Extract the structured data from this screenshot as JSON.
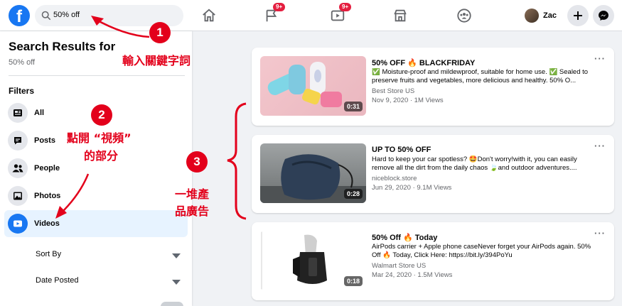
{
  "search": {
    "value": "50% off"
  },
  "nav": {
    "badge_pages": "9+",
    "badge_watch": "9+"
  },
  "profile": {
    "name": "Zac"
  },
  "sidebar": {
    "title": "Search Results for",
    "query": "50% off",
    "filters_label": "Filters",
    "items": [
      {
        "label": "All",
        "icon": "all-icon"
      },
      {
        "label": "Posts",
        "icon": "posts-icon"
      },
      {
        "label": "People",
        "icon": "people-icon"
      },
      {
        "label": "Photos",
        "icon": "photos-icon"
      },
      {
        "label": "Videos",
        "icon": "videos-icon",
        "active": true
      }
    ],
    "sub_filters": [
      {
        "label": "Sort By"
      },
      {
        "label": "Date Posted"
      }
    ]
  },
  "results": [
    {
      "title": "50% OFF 🔥 BLACKFRIDAY",
      "desc": "✅ Moisture-proof and mildewproof, suitable for home use. ✅ Sealed to preserve fruits and vegetables, more delicious and healthy. 50% O...",
      "source": "Best Store US",
      "meta": "Nov 9, 2020 · 1M Views",
      "duration": "0:31"
    },
    {
      "title": "UP TO 50% OFF",
      "desc": "Hard to keep your car spotless? 🤩Don't worry!with it, you can easily remove all the dirt from the daily chaos 🍃and outdoor adventures....",
      "source": "niceblock.store",
      "meta": "Jun 29, 2020 · 9.1M Views",
      "duration": "0:28"
    },
    {
      "title": "50% Off 🔥 Today",
      "desc": "AirPods carrier + Apple phone caseNever forget your AirPods again. 50% Off 🔥 Today, Click Here: https://bit.ly/394PoYu",
      "source": "Walmart Store US",
      "meta": "Mar 24, 2020 · 1.5M Views",
      "duration": "0:18"
    }
  ],
  "annotations": {
    "step1_num": "1",
    "step1_text": "輸入關鍵字詞",
    "step2_num": "2",
    "step2_line1": "點開 “視頻”",
    "step2_line2": "的部分",
    "step3_num": "3",
    "step3_line1": "一堆產",
    "step3_line2": "品廣告"
  },
  "colors": {
    "brand": "#1877f2",
    "annotation": "#e3001b",
    "badge": "#e41e3f"
  }
}
